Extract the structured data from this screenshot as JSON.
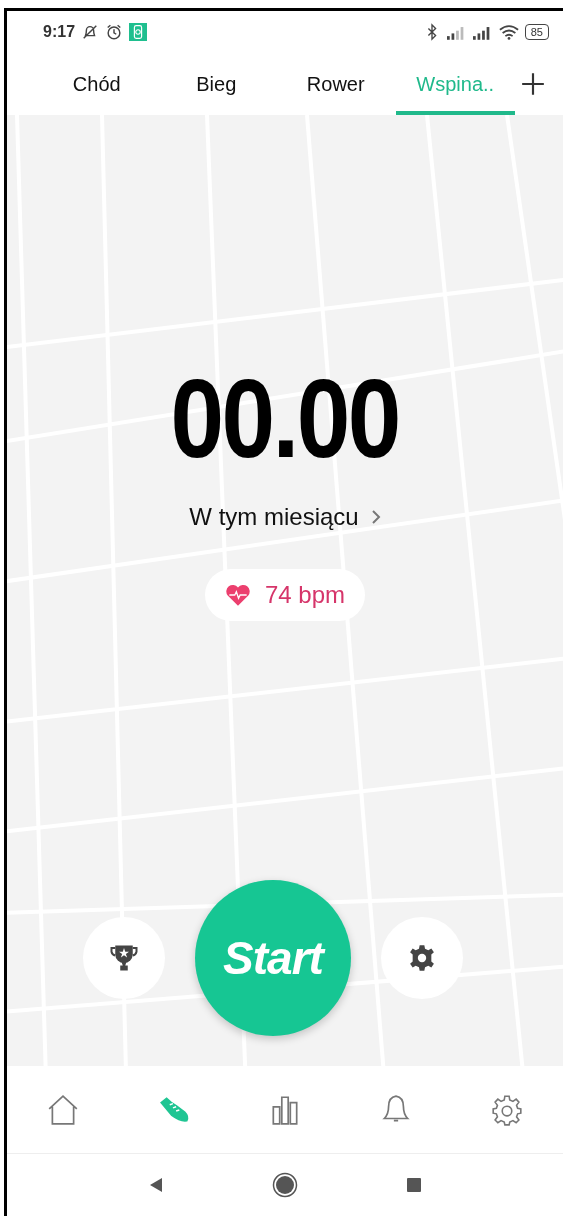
{
  "status_bar": {
    "time": "9:17",
    "battery": "85"
  },
  "tabs": [
    {
      "label": "Chód",
      "selected": false
    },
    {
      "label": "Bieg",
      "selected": false
    },
    {
      "label": "Rower",
      "selected": false
    },
    {
      "label": "Wspina..",
      "selected": true
    }
  ],
  "summary": {
    "value": "00.00",
    "period": "W tym miesiącu"
  },
  "heart_rate": {
    "reading": "74 bpm"
  },
  "start_button": {
    "label": "Start"
  },
  "bottom_nav": [
    {
      "kind": "home",
      "selected": false
    },
    {
      "kind": "workout",
      "selected": true
    },
    {
      "kind": "stats",
      "selected": false
    },
    {
      "kind": "alerts",
      "selected": false
    },
    {
      "kind": "settings",
      "selected": false
    }
  ]
}
